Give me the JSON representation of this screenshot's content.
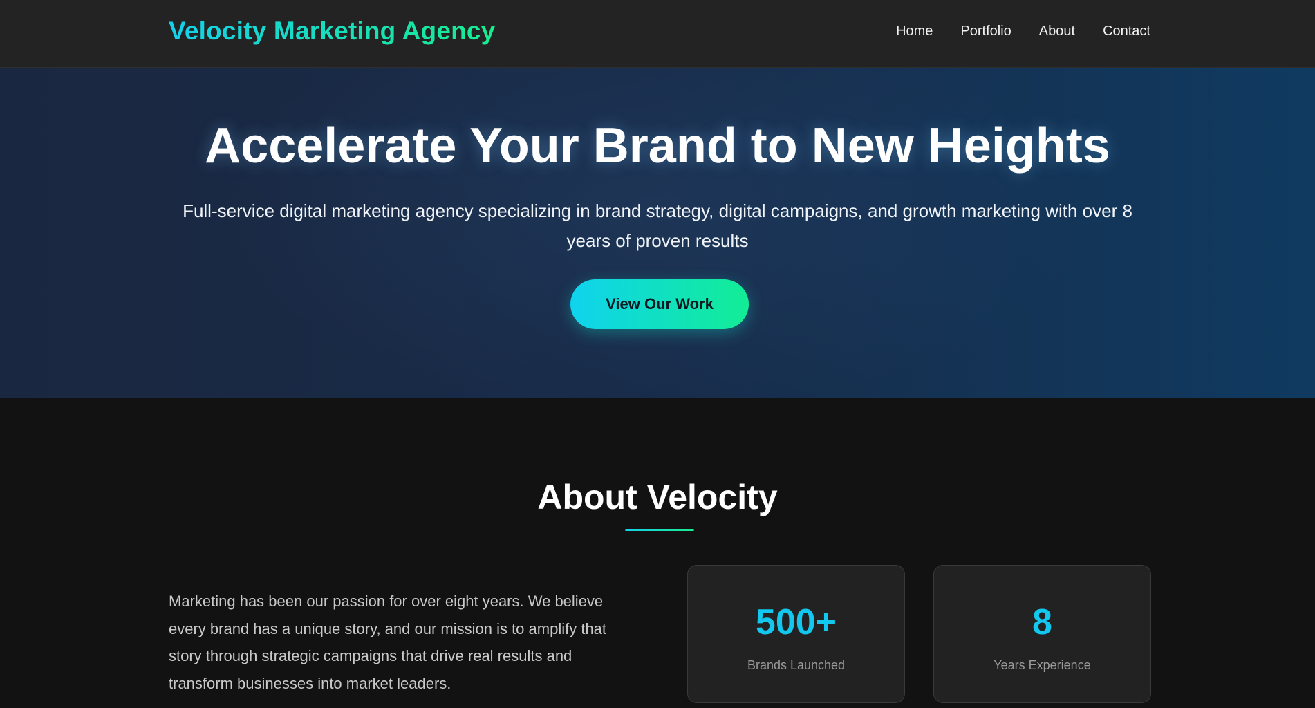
{
  "navbar": {
    "brand": "Velocity Marketing Agency",
    "links": [
      "Home",
      "Portfolio",
      "About",
      "Contact"
    ]
  },
  "hero": {
    "title": "Accelerate Your Brand to New Heights",
    "subtitle": "Full-service digital marketing agency specializing in brand strategy, digital campaigns, and growth marketing with over 8 years of proven results",
    "cta_label": "View Our Work"
  },
  "about": {
    "title": "About Velocity",
    "text": "Marketing has been our passion for over eight years. We believe every brand has a unique story, and our mission is to amplify that story through strategic campaigns that drive real results and transform businesses into market leaders.",
    "stats": [
      {
        "value": "500+",
        "label": "Brands Launched"
      },
      {
        "value": "8",
        "label": "Years Experience"
      }
    ]
  },
  "colors": {
    "accent_start": "#16d0ea",
    "accent_end": "#19ec8f",
    "stat_value": "#12c8ee",
    "background": "#121212",
    "navbar": "#232323"
  }
}
